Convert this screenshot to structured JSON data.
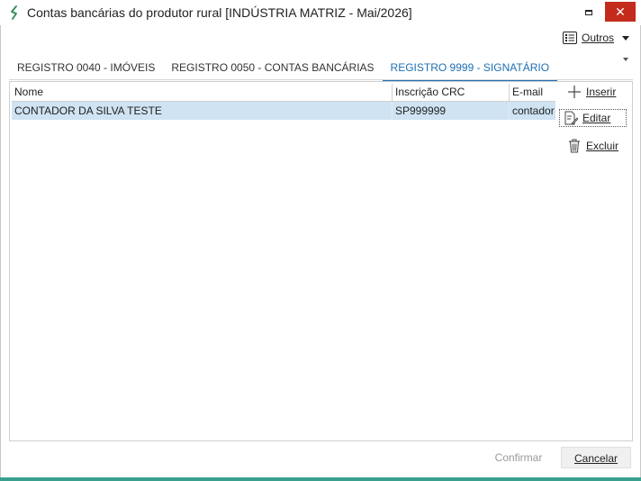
{
  "window": {
    "title": "Contas bancárias do produtor rural [INDÚSTRIA MATRIZ - Mai/2026]",
    "close_glyph": "✕"
  },
  "toolbar": {
    "outros_label": "Outros"
  },
  "tabs": [
    {
      "label": "REGISTRO 0040 - IMÓVEIS",
      "active": false
    },
    {
      "label": "REGISTRO 0050 - CONTAS BANCÁRIAS",
      "active": false
    },
    {
      "label": "REGISTRO 9999 - SIGNATÁRIO",
      "active": true
    }
  ],
  "grid": {
    "columns": [
      "Nome",
      "Inscrição CRC",
      "E-mail"
    ],
    "rows": [
      [
        "CONTADOR DA SILVA TESTE",
        "SP999999",
        "contador"
      ]
    ]
  },
  "actions": {
    "inserir": "Inserir",
    "editar": "Editar",
    "excluir": "Excluir"
  },
  "footer": {
    "confirmar": "Confirmar",
    "cancelar": "Cancelar"
  },
  "colors": {
    "accent": "#1e6fb3",
    "selected_row": "#cfe3f3",
    "close_button": "#c42b1c",
    "bottom_accent": "#3aa08e"
  }
}
